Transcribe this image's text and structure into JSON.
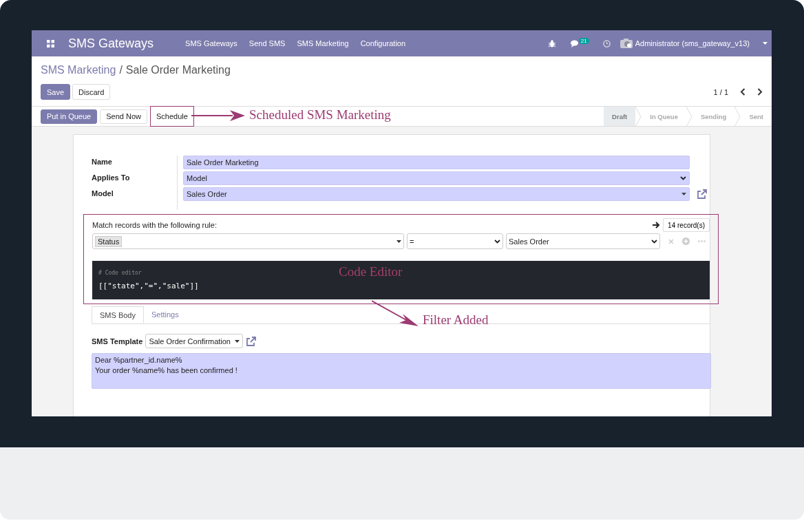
{
  "navbar": {
    "app_title": "SMS Gateways",
    "menu": [
      "SMS Gateways",
      "Send SMS",
      "SMS Marketing",
      "Configuration"
    ],
    "message_count": "21",
    "user": "Administrator (sms_gateway_v13)"
  },
  "breadcrumb": {
    "parent": "SMS Marketing",
    "separator": "/",
    "current": "Sale Order Marketing"
  },
  "edit_buttons": [
    {
      "label": "Save",
      "kind": "primary"
    },
    {
      "label": "Discard",
      "kind": "secondary"
    }
  ],
  "pager": "1 / 1",
  "actions": [
    {
      "label": "Put in Queue",
      "kind": "primary",
      "highlighted": false
    },
    {
      "label": "Send Now",
      "kind": "secondary",
      "highlighted": false
    },
    {
      "label": "Schedule",
      "kind": "secondary",
      "highlighted": true
    }
  ],
  "stages": [
    {
      "label": "Draft",
      "selected": true
    },
    {
      "label": "In Queue",
      "selected": false
    },
    {
      "label": "Sending",
      "selected": false
    },
    {
      "label": "Sent",
      "selected": false
    }
  ],
  "form": {
    "fields": [
      {
        "label": "Name",
        "value": "Sale Order Marketing",
        "kind": "text"
      },
      {
        "label": "Applies To",
        "value": "Model",
        "kind": "select"
      },
      {
        "label": "Model",
        "value": "Sales Order",
        "kind": "many2one"
      }
    ],
    "domain": {
      "highlighted": true,
      "caption": "Match records with the following rule:",
      "record_count": "14 record(s)",
      "field": "Status",
      "operator": "=",
      "value": "Sales Order",
      "code_comment": "# Code editor",
      "code": "[[\"state\",\"=\",\"sale\"]]"
    },
    "tabs": [
      {
        "label": "SMS Body",
        "selected": true
      },
      {
        "label": "Settings",
        "selected": false
      }
    ],
    "template": {
      "label": "SMS Template",
      "value": "Sale Order Confirmation"
    },
    "body_lines": [
      "Dear %partner_id.name%",
      "Your order %name% has been confirmed !"
    ]
  },
  "annotations": [
    {
      "text": "Scheduled SMS Marketing",
      "kind": "arrow-right"
    },
    {
      "text": "Code Editor",
      "kind": "label"
    },
    {
      "text": "Filter Added",
      "kind": "arrow-down"
    }
  ]
}
